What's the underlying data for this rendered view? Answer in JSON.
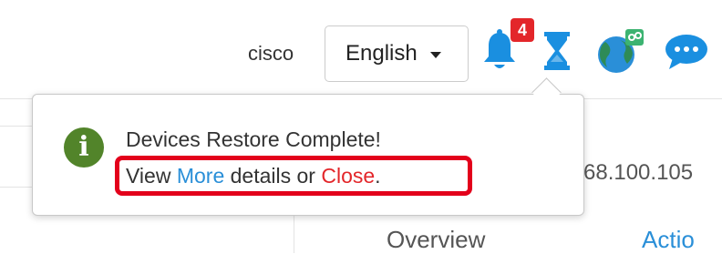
{
  "header": {
    "user": "cisco",
    "language": {
      "selected": "English"
    },
    "notifications": {
      "count": "4"
    }
  },
  "background": {
    "ip_partial": "68.100.105",
    "tabs": [
      "Overview",
      "Actio"
    ]
  },
  "popover": {
    "title": "Devices Restore Complete!",
    "view_text": "View ",
    "more_link": "More",
    "middle_text": " details or ",
    "close_link": "Close",
    "end_text": "."
  },
  "colors": {
    "bell": "#1a8fe0",
    "hourglass": "#1a8fe0",
    "globe_land": "#2e8b57",
    "globe_sea": "#2a8fd8",
    "chat": "#1a8fe0",
    "badge": "#e3262a",
    "info": "#52842a",
    "link_blue": "#2a8fd8",
    "link_red": "#e3262a",
    "highlight": "#e3001b"
  }
}
